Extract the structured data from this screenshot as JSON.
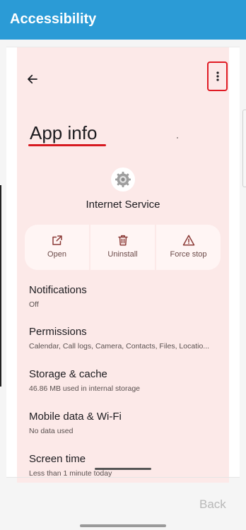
{
  "titlebar": {
    "title": "Accessibility"
  },
  "app_info": {
    "title": "App info",
    "app_name": "Internet Service",
    "actions": [
      {
        "label": "Open",
        "icon": "open-in-new-icon"
      },
      {
        "label": "Uninstall",
        "icon": "trash-icon"
      },
      {
        "label": "Force stop",
        "icon": "warning-icon"
      }
    ],
    "settings": [
      {
        "title": "Notifications",
        "subtitle": "Off"
      },
      {
        "title": "Permissions",
        "subtitle": "Calendar, Call logs, Camera, Contacts, Files, Locatio..."
      },
      {
        "title": "Storage & cache",
        "subtitle": "46.86 MB used in internal storage"
      },
      {
        "title": "Mobile data & Wi-Fi",
        "subtitle": "No data used"
      },
      {
        "title": "Screen time",
        "subtitle": "Less than 1 minute today"
      }
    ]
  },
  "footer": {
    "back_label": "Back"
  },
  "colors": {
    "titlebar": "#2b9bd6",
    "panel": "#fce9e8",
    "highlight": "#e01b24"
  }
}
